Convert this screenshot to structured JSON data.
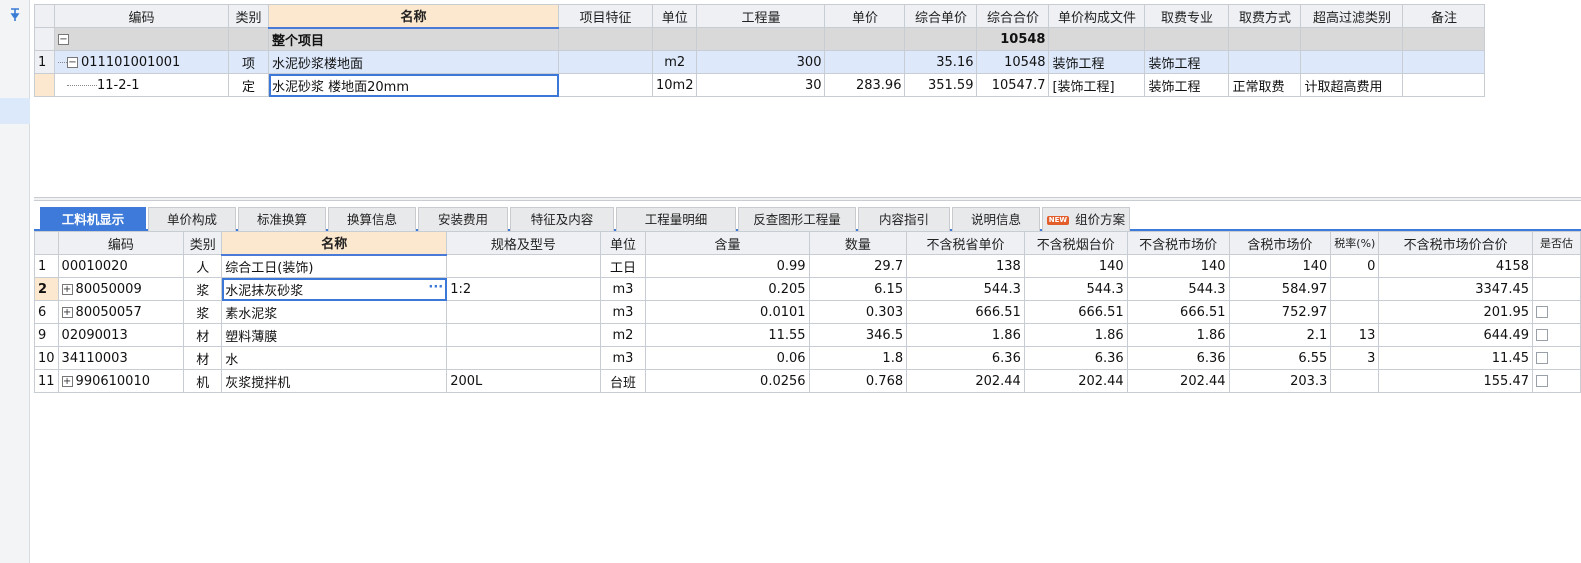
{
  "top_grid": {
    "headers": [
      "编码",
      "类别",
      "名称",
      "项目特征",
      "单位",
      "工程量",
      "单价",
      "综合单价",
      "综合合价",
      "单价构成文件",
      "取费专业",
      "取费方式",
      "超高过滤类别",
      "备注"
    ],
    "group_row": {
      "expander": "−",
      "name": "整个项目",
      "total": "10548"
    },
    "rows": [
      {
        "rownum": "1",
        "code": "011101001001",
        "type": "项",
        "name": "水泥砂浆楼地面",
        "feature": "",
        "unit": "m2",
        "qty": "300",
        "price": "",
        "comp_price": "35.16",
        "comp_total": "10548",
        "price_file": "装饰工程",
        "fee_major": "装饰工程",
        "fee_method": "",
        "filter": "",
        "remark": ""
      },
      {
        "rownum": "",
        "code": "11-2-1",
        "type": "定",
        "name": "水泥砂浆 楼地面20mm",
        "feature": "",
        "unit": "10m2",
        "qty": "30",
        "price": "283.96",
        "comp_price": "351.59",
        "comp_total": "10547.7",
        "price_file": "[装饰工程]",
        "fee_major": "装饰工程",
        "fee_method": "正常取费",
        "filter": "计取超高费用",
        "remark": ""
      }
    ]
  },
  "tabs": [
    {
      "label": "工料机显示",
      "active": true
    },
    {
      "label": "单价构成"
    },
    {
      "label": "标准换算"
    },
    {
      "label": "换算信息"
    },
    {
      "label": "安装费用"
    },
    {
      "label": "特征及内容"
    },
    {
      "label": "工程量明细"
    },
    {
      "label": "反查图形工程量"
    },
    {
      "label": "内容指引"
    },
    {
      "label": "说明信息"
    },
    {
      "label": "组价方案",
      "badge": "NEW"
    }
  ],
  "bottom_grid": {
    "headers": [
      "编码",
      "类别",
      "名称",
      "规格及型号",
      "单位",
      "含量",
      "数量",
      "不含税省单价",
      "不含税烟台价",
      "不含税市场价",
      "含税市场价",
      "税率(%)",
      "不含税市场价合价",
      "是否估"
    ],
    "rows": [
      {
        "rownum": "1",
        "expander": "",
        "code": "00010020",
        "type": "人",
        "name": "综合工日(装饰)",
        "spec": "",
        "unit": "工日",
        "content": "0.99",
        "qty": "29.7",
        "p1": "138",
        "p2": "140",
        "p3": "140",
        "p4": "140",
        "tax": "0",
        "total": "4158"
      },
      {
        "rownum": "2",
        "expander": "+",
        "code": "80050009",
        "type": "浆",
        "name": "水泥抹灰砂浆",
        "spec": "1:2",
        "unit": "m3",
        "content": "0.205",
        "qty": "6.15",
        "p1": "544.3",
        "p2": "544.3",
        "p3": "544.3",
        "p4": "584.97",
        "tax": "",
        "total": "3347.45"
      },
      {
        "rownum": "6",
        "expander": "+",
        "code": "80050057",
        "type": "浆",
        "name": "素水泥浆",
        "spec": "",
        "unit": "m3",
        "content": "0.0101",
        "qty": "0.303",
        "p1": "666.51",
        "p2": "666.51",
        "p3": "666.51",
        "p4": "752.97",
        "tax": "",
        "total": "201.95"
      },
      {
        "rownum": "9",
        "expander": "",
        "code": "02090013",
        "type": "材",
        "name": "塑料薄膜",
        "spec": "",
        "unit": "m2",
        "content": "11.55",
        "qty": "346.5",
        "p1": "1.86",
        "p2": "1.86",
        "p3": "1.86",
        "p4": "2.1",
        "tax": "13",
        "total": "644.49"
      },
      {
        "rownum": "10",
        "expander": "",
        "code": "34110003",
        "type": "材",
        "name": "水",
        "spec": "",
        "unit": "m3",
        "content": "0.06",
        "qty": "1.8",
        "p1": "6.36",
        "p2": "6.36",
        "p3": "6.36",
        "p4": "6.55",
        "tax": "3",
        "total": "11.45"
      },
      {
        "rownum": "11",
        "expander": "+",
        "code": "990610010",
        "type": "机",
        "name": "灰浆搅拌机",
        "spec": "200L",
        "unit": "台班",
        "content": "0.0256",
        "qty": "0.768",
        "p1": "202.44",
        "p2": "202.44",
        "p3": "202.44",
        "p4": "203.3",
        "tax": "",
        "total": "155.47"
      }
    ]
  }
}
